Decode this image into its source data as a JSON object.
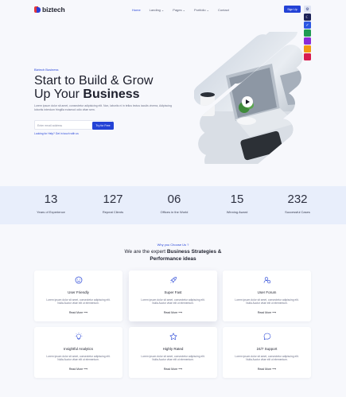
{
  "brand": {
    "name": "biztech"
  },
  "nav": {
    "items": [
      {
        "label": "Home",
        "has_caret": false,
        "active": true
      },
      {
        "label": "Landing",
        "has_caret": true,
        "active": false
      },
      {
        "label": "Pages",
        "has_caret": true,
        "active": false
      },
      {
        "label": "Portfolio",
        "has_caret": true,
        "active": false
      },
      {
        "label": "Contact",
        "has_caret": false,
        "active": false
      }
    ],
    "signup_label": "Sign Up"
  },
  "switcher": {
    "theme_colors": [
      "#2b57e2",
      "#1f9a52",
      "#8a2bd9",
      "#f29a12",
      "#d81b4e"
    ]
  },
  "hero": {
    "tagline": "Biztech Business",
    "title_line1": "Start to Build & Grow",
    "title_line2_plain": "Up Your ",
    "title_line2_bold": "Business",
    "lead": "Lorem ipsum dolor sit amet, consectetur adipisicing elit. Non, laboriis ni in tellus lectus iaculis viverra, Adipiscing lobortis interdum fringilla euismod odio vitae sem.",
    "email_placeholder": "Enter email address",
    "try_label": "Try for Free",
    "hint": "Looking for Help? Get in touch with us"
  },
  "stats": [
    {
      "value": "13",
      "label": "Years of  Experience"
    },
    {
      "value": "127",
      "label": "Repeat Clients"
    },
    {
      "value": "06",
      "label": "Offices in the World"
    },
    {
      "value": "15",
      "label": "Winning Award"
    },
    {
      "value": "232",
      "label": "Successful Cases"
    }
  ],
  "why": {
    "tag": "Why you Choose Us ?",
    "title_plain": "We are the expert ",
    "title_bold1": "Business Strategies &",
    "title_bold2": "Performance ideas"
  },
  "features": [
    {
      "title": "User Friendly",
      "icon": "smile-icon",
      "desc": "Lorem ipsum dolor sit amet, consectetur adipiscing elit. Nulla Auctor vitae elit ut elementum.",
      "link": "Read More"
    },
    {
      "title": "Super Fast",
      "icon": "rocket-icon",
      "desc": "Lorem ipsum dolor sit amet, consectetur adipiscing elit. Nulla Auctor vitae elit ut elementum.",
      "link": "Read More"
    },
    {
      "title": "User Forum",
      "icon": "users-icon",
      "desc": "Lorem ipsum dolor sit amet, consectetur adipiscing elit. Nulla Auctor vitae elit ut elementum.",
      "link": "Read More"
    },
    {
      "title": "Insightful Analytics",
      "icon": "lightbulb-icon",
      "desc": "Lorem ipsum dolor sit amet, consectetur adipiscing elit. Nulla Auctor vitae elit ut elementum.",
      "link": "Read More"
    },
    {
      "title": "Highly Rated",
      "icon": "star-icon",
      "desc": "Lorem ipsum dolor sit amet, consectetur adipiscing elit. Nulla Auctor vitae elit ut elementum.",
      "link": "Read More"
    },
    {
      "title": "24/7 Support",
      "icon": "chat-icon",
      "desc": "Lorem ipsum dolor sit amet, consectetur adipiscing elit. Nulla Auctor vitae elit ut elementum.",
      "link": "Read More"
    }
  ],
  "colors": {
    "accent": "#2342d6",
    "stats_band": "#e8eefb",
    "page_bg": "#f7f8fc"
  }
}
